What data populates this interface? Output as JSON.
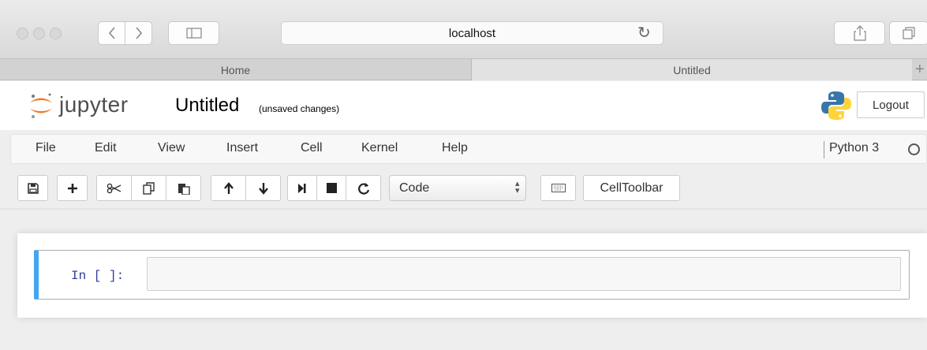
{
  "browser": {
    "url": "localhost",
    "tabs": [
      {
        "label": "Home"
      },
      {
        "label": "Untitled"
      }
    ],
    "new_tab_symbol": "+"
  },
  "header": {
    "logo_text": "jupyter",
    "notebook_title": "Untitled",
    "save_status": "(unsaved changes)",
    "logout_label": "Logout"
  },
  "menubar": {
    "items": [
      {
        "label": "File"
      },
      {
        "label": "Edit"
      },
      {
        "label": "View"
      },
      {
        "label": "Insert"
      },
      {
        "label": "Cell"
      },
      {
        "label": "Kernel"
      },
      {
        "label": "Help"
      }
    ],
    "kernel_name": "Python 3"
  },
  "toolbar": {
    "cell_type": "Code",
    "celltoolbar_label": "CellToolbar",
    "icons": [
      "save-icon",
      "plus-icon",
      "cut-icon",
      "copy-icon",
      "paste-icon",
      "arrow-up-icon",
      "arrow-down-icon",
      "step-forward-icon",
      "stop-icon",
      "refresh-icon",
      "keyboard-icon"
    ]
  },
  "cell": {
    "prompt": "In [ ]:",
    "content": ""
  },
  "colors": {
    "cell_selected_border": "#42a5f5",
    "prompt_color": "#303f9f",
    "jupyter_orange": "#f37726"
  }
}
